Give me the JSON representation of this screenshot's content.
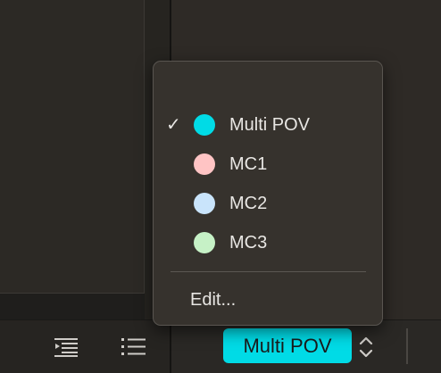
{
  "menu": {
    "items": [
      {
        "label": "Multi POV",
        "checked": true,
        "check_mark": "✓",
        "color": "#00dbe6"
      },
      {
        "label": "MC1",
        "checked": false,
        "check_mark": "",
        "color": "#ffc4c4"
      },
      {
        "label": "MC2",
        "checked": false,
        "check_mark": "",
        "color": "#c9e4fb"
      },
      {
        "label": "MC3",
        "checked": false,
        "check_mark": "",
        "color": "#c6f1c6"
      }
    ],
    "edit_label": "Edit..."
  },
  "toolbar": {
    "angle_button_label": "Multi POV",
    "angle_button_color": "#00dbe6",
    "icons": [
      "align-lines-icon",
      "bullet-list-icon",
      "up-down-stepper-icon"
    ]
  }
}
